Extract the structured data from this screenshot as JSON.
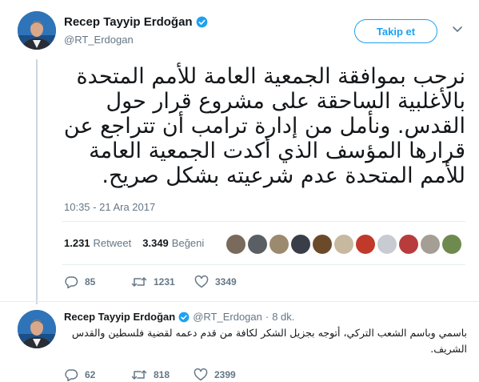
{
  "main_tweet": {
    "author_name": "Recep Tayyip Erdoğan",
    "handle": "@RT_Erdogan",
    "follow_label": "Takip et",
    "text": "نرحب بموافقة الجمعية العامة للأمم المتحدة بالأغلبية الساحقة على مشروع قرار حول القدس. ونأمل من إدارة ترامب أن تتراجع عن قرارها المؤسف الذي أكدت الجمعية العامة للأمم المتحدة عدم شرعيته بشكل صريح.",
    "timestamp": "10:35 - 21 Ara 2017",
    "retweet_count": "1.231",
    "retweet_label": "Retweet",
    "like_count": "3.349",
    "like_label": "Beğeni",
    "liker_colors": [
      "#7a6a5c",
      "#5a5f63",
      "#9c8a6e",
      "#3a3e48",
      "#6b4a2a",
      "#c7b8a0",
      "#c0392b",
      "#c8ccd2",
      "#b83c3c",
      "#a59e95",
      "#6f8a4e"
    ],
    "actions": {
      "replies": "85",
      "retweets": "1231",
      "likes": "3349"
    }
  },
  "reply_tweet": {
    "author_name": "Recep Tayyip Erdoğan",
    "handle": "@RT_Erdogan",
    "separator": "·",
    "age": "8 dk.",
    "text": "باسمي وباسم الشعب التركي، أتوجه بجزيل الشكر لكافة من قدم دعمه لقضية فلسطين والقدس الشريف.",
    "actions": {
      "replies": "62",
      "retweets": "818",
      "likes": "2399"
    }
  },
  "colors": {
    "accent": "#1da1f2",
    "secondary_text": "#657786",
    "divider": "#e6ecf0"
  },
  "icons": [
    "verified-badge-icon",
    "chevron-down-icon",
    "reply-icon",
    "retweet-icon",
    "heart-icon"
  ]
}
